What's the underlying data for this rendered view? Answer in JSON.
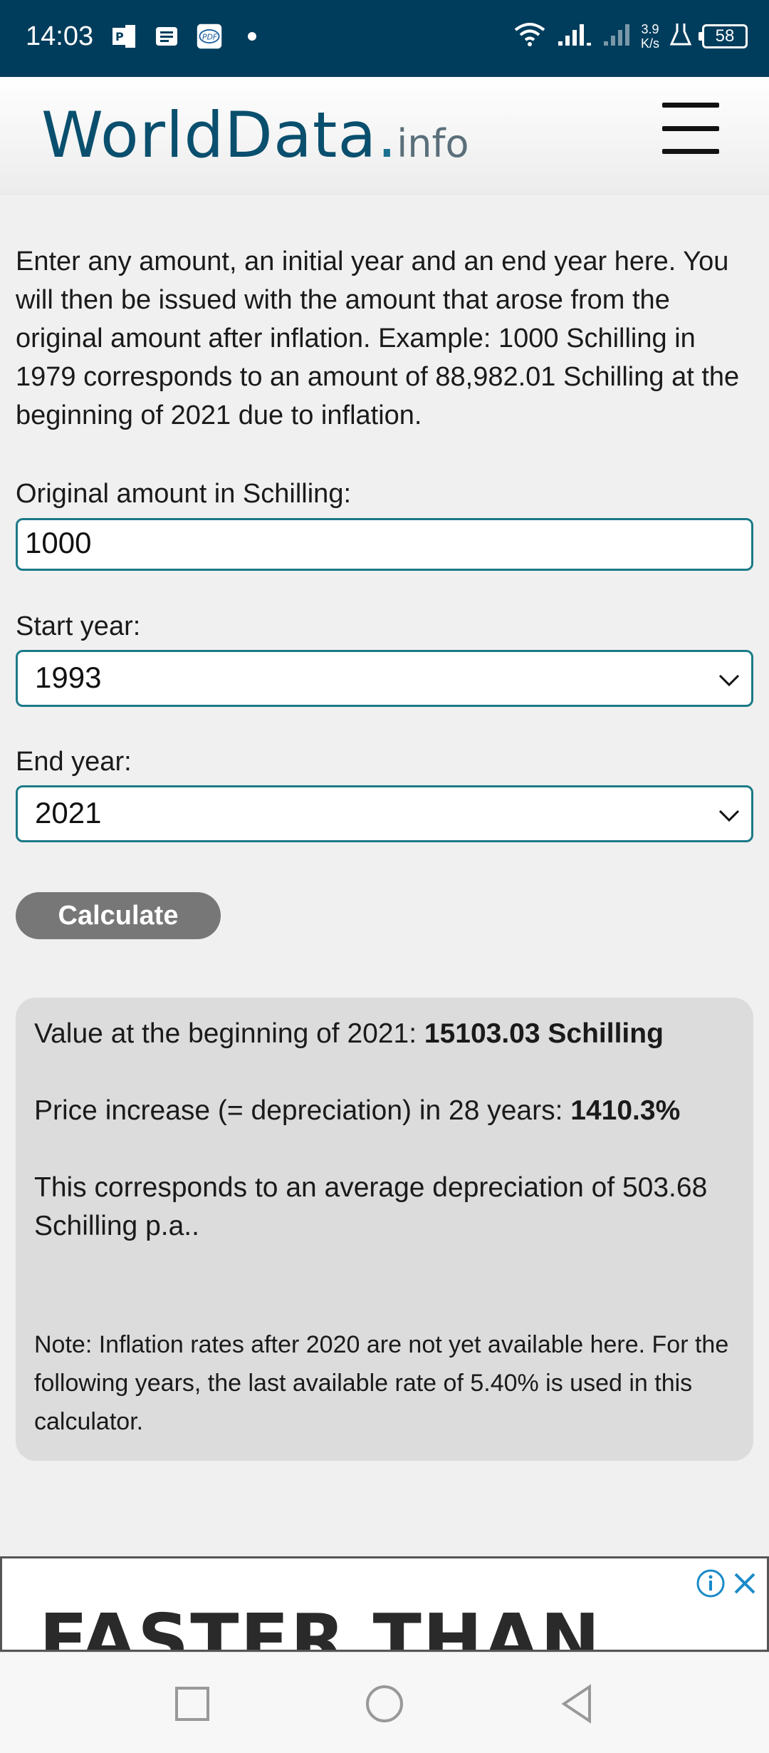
{
  "status_bar": {
    "time": "14:03",
    "net_speed_value": "3.9",
    "net_speed_unit": "K/s",
    "battery": "58",
    "icons": [
      "office-icon",
      "message-icon",
      "pdf-icon",
      "dot-icon",
      "wifi-icon",
      "signal-icon",
      "signal-icon-2",
      "lab-icon",
      "battery-icon"
    ]
  },
  "header": {
    "logo_main": "WorldData",
    "logo_dot": ".",
    "logo_sub": "info",
    "menu_icon": "hamburger-icon"
  },
  "intro_text": "Enter any amount, an initial year and an end year here. You will then be issued with the amount that arose from the original amount after inflation. Example: 1000 Schilling in 1979 corresponds to an amount of 88,982.01 Schilling at the beginning of 2021 due to inflation.",
  "form": {
    "amount_label": "Original amount in Schilling:",
    "amount_value": "1000",
    "start_label": "Start year:",
    "start_value": "1993",
    "end_label": "End year:",
    "end_value": "2021",
    "calculate_label": "Calculate"
  },
  "result": {
    "value_prefix": "Value at the beginning of 2021: ",
    "value_bold": "15103.03 Schilling",
    "increase_prefix": "Price increase (= depreciation) in 28 years: ",
    "increase_bold": "1410.3%",
    "avg_text": "This corresponds to an average depreciation of 503.68 Schilling p.a..",
    "note": "Note: Inflation rates after 2020 are not yet available here. For the following years, the last available rate of 5.40% is used in this calculator."
  },
  "ad": {
    "text": "FASTER THAN"
  },
  "colors": {
    "status_bar": "#003d5c",
    "accent_border": "#1b7a87",
    "logo": "#0a4f6e",
    "button": "#777777",
    "result_bg": "#dcdcdc"
  }
}
